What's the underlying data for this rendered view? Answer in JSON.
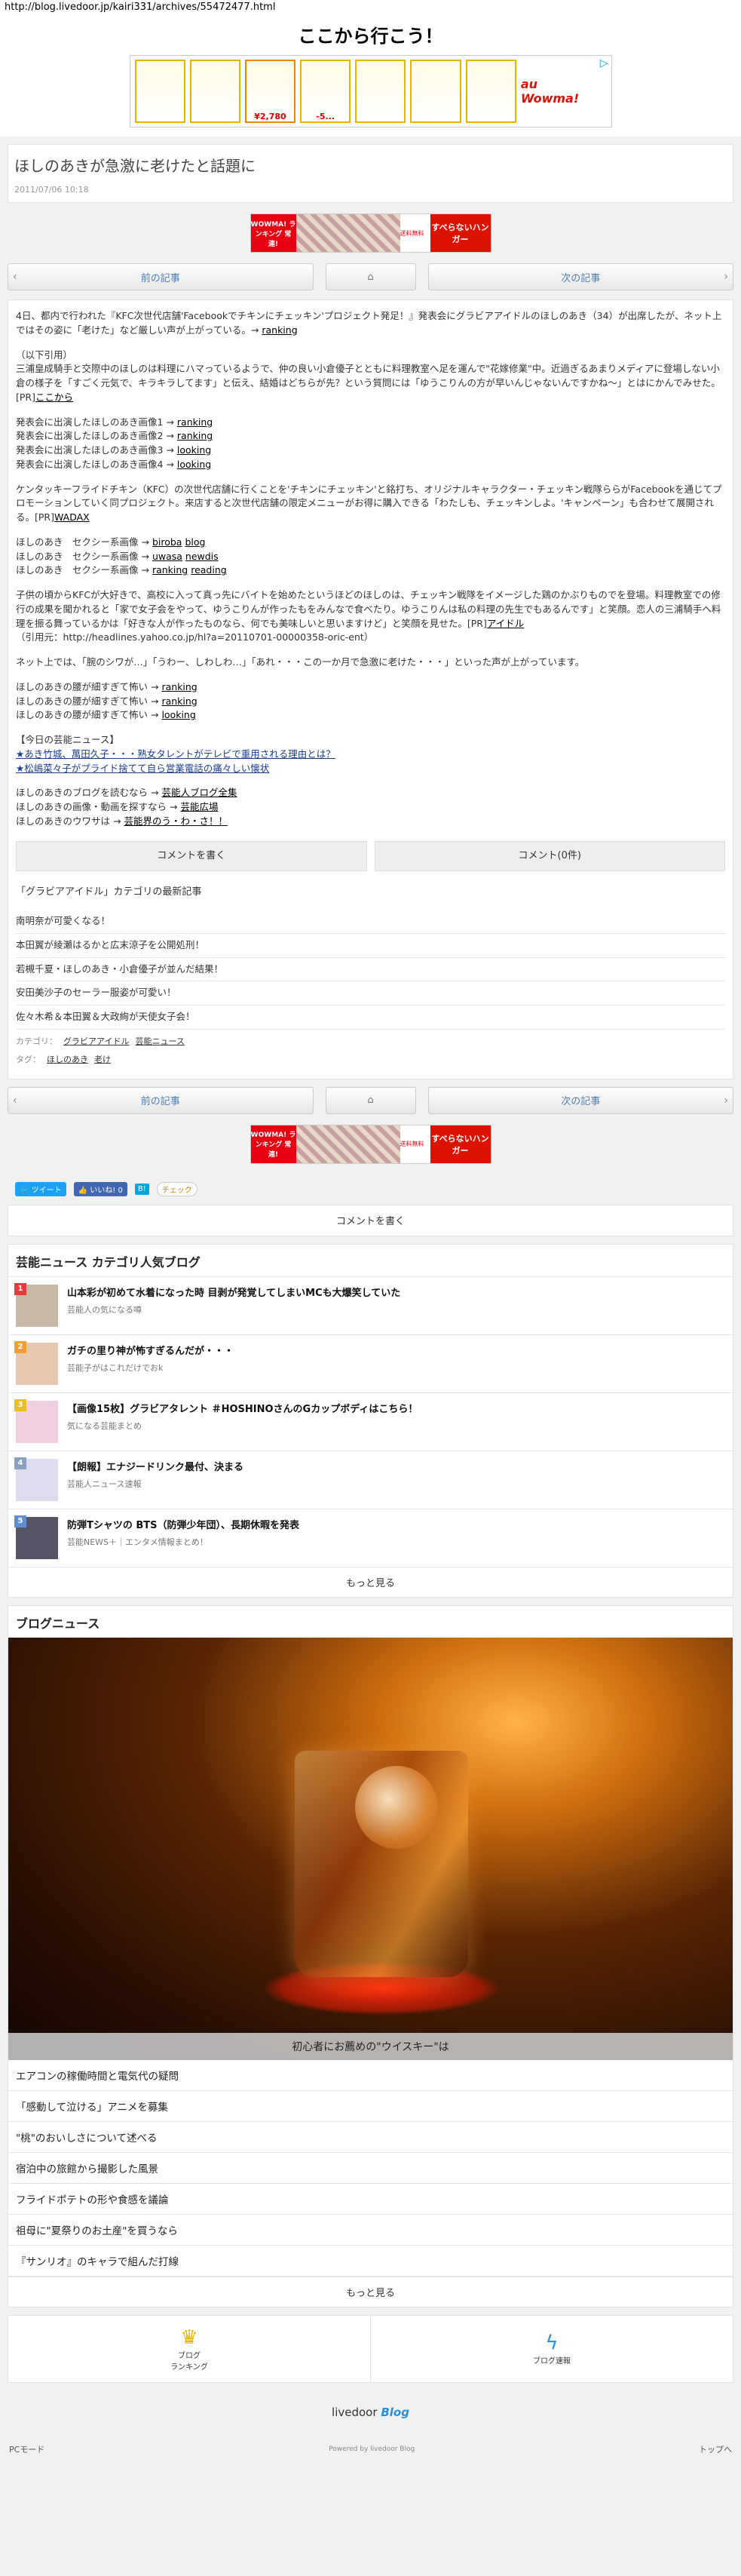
{
  "url": "http://blog.livedoor.jp/kairi331/archives/55472477.html",
  "page_heading": "ここから行こう！",
  "banner": {
    "price": "¥2,780",
    "discount": "-5...",
    "logo": "au Wowma!"
  },
  "post": {
    "title": "ほしのあきが急激に老けたと話題に",
    "date": "2011/07/06 10:18"
  },
  "wowma_ad": {
    "left": "WOWMA! ランキング 常連!",
    "badge": "送料無料",
    "right": "すべらないハンガー"
  },
  "nav": {
    "prev": "前の記事",
    "next": "次の記事"
  },
  "article": {
    "intro": "4日、都内で行われた『KFC次世代店舗'Facebookでチキンにチェッキン'プロジェクト発足！』発表会にグラビアアイドルのほしのあき（34）が出席したが、ネット上ではその姿に「老けた」など厳しい声が上がっている。→",
    "intro_link": "ranking",
    "quote_head": "（以下引用）",
    "quote_body": "三浦皇成騎手と交際中のほしのは料理にハマっているようで、仲の良い小倉優子とともに料理教室へ足を運んで\"花嫁修業\"中。近過ぎるあまりメディアに登場しない小倉の様子を「すごく元気で、キラキラしてます」と伝え、結婚はどちらが先？という質問には「ゆうこりんの方が早いんじゃないんですかね～」とはにかんでみせた。[PR]",
    "quote_link": "ここから",
    "img_lines": [
      {
        "text": "発表会に出演したほしのあき画像1 →",
        "link": "ranking"
      },
      {
        "text": "発表会に出演したほしのあき画像2 →",
        "link": "ranking"
      },
      {
        "text": "発表会に出演したほしのあき画像3 →",
        "link": "looking"
      },
      {
        "text": "発表会に出演したほしのあき画像4 →",
        "link": "looking"
      }
    ],
    "kfc_para": "ケンタッキーフライドチキン（KFC）の次世代店舗に行くことを'チキンにチェッキン'と銘打ち、オリジナルキャラクター・チェッキン戦隊ららがFacebookを通じてプロモーションしていく同プロジェクト。来店すると次世代店舗の限定メニューがお得に購入できる「わたしも、チェッキンしよ。'キャンペーン」も合わせて展開される。[PR]",
    "kfc_link": "WADAX",
    "sexy_lines": [
      {
        "text": "ほしのあき　セクシー系画像 →",
        "links": [
          "biroba",
          "blog"
        ]
      },
      {
        "text": "ほしのあき　セクシー系画像 →",
        "links": [
          "uwasa",
          "newdis"
        ]
      },
      {
        "text": "ほしのあき　セクシー系画像 →",
        "links": [
          "ranking",
          "reading"
        ]
      }
    ],
    "story_para": "子供の頃からKFCが大好きで、高校に入って真っ先にバイトを始めたというほどのほしのは、チェッキン戦隊をイメージした鶏のかぶりものでを登場。料理教室での修行の成果を聞かれると「家で女子会をやって、ゆうこりんが作ったもをみんなで食べたり。ゆうこりんは私の料理の先生でもあるんです」と笑顔。恋人の三浦騎手へ料理を振る舞っているかは「好きな人が作ったものなら、何でも美味しいと思いますけど」と笑顔を見せた。[PR]",
    "story_link": "アイドル",
    "source": "（引用元：http://headlines.yahoo.co.jp/hl?a=20110701-00000358-oric-ent）",
    "net_para": "ネット上では、「腕のシワが…」「うわー、しわしわ…」「あれ・・・この一か月で急激に老けた・・・」といった声が上がっています。",
    "waist_lines": [
      {
        "text": "ほしのあきの腰が細すぎて怖い →",
        "link": "ranking"
      },
      {
        "text": "ほしのあきの腰が細すぎて怖い →",
        "link": "ranking"
      },
      {
        "text": "ほしのあきの腰が細すぎて怖い →",
        "link": "looking"
      }
    ],
    "today_head": "【今日の芸能ニュース】",
    "today_items": [
      "★あき竹城、萬田久子・・・熟女タレントがテレビで重用される理由とは？",
      "★松嶋菜々子がプライド捨てて自ら営業電話の痛々しい懐状"
    ],
    "more_lines": [
      {
        "text": "ほしのあきのブログを読むなら →",
        "link": "芸能人ブログ全集"
      },
      {
        "text": "ほしのあきの画像・動画を探すなら →",
        "link": "芸能広場"
      },
      {
        "text": "ほしのあきのウワサは →",
        "link": "芸能界のう・わ・さ！！"
      }
    ]
  },
  "buttons": {
    "write_comment": "コメントを書く",
    "comment_count": "コメント(0件)"
  },
  "category": {
    "heading": "「グラビアアイドル」カテゴリの最新記事",
    "items": [
      "南明奈が可愛くなる！",
      "本田翼が綾瀬はるかと広末涼子を公開処刑！",
      "若槻千夏・ほしのあき・小倉優子が並んだ結果！",
      "安田美沙子のセーラー服姿が可愛い！",
      "佐々木希＆本田翼＆大政絢が天使女子会！"
    ],
    "cat_label": "カテゴリ：",
    "cat_values": [
      "グラビアアイドル",
      "芸能ニュース"
    ],
    "tag_label": "タグ：",
    "tag_values": [
      "ほしのあき",
      "老け"
    ]
  },
  "social": {
    "tweet": "ツイート",
    "like": "いいね! 0",
    "hatena": "B!",
    "mixi": "チェック"
  },
  "comment_bar": "コメントを書く",
  "ranking": {
    "title": "芸能ニュース カテゴリ人気ブログ",
    "items": [
      {
        "num": "1",
        "title": "山本彩が初めて水着になった時 目剥が発覚してしまいMCも大爆笑していた",
        "sub": "芸能人の気になる噂",
        "color": "#e43b3b"
      },
      {
        "num": "2",
        "title": "ガチの里り神が怖すぎるんだが・・・",
        "sub": "芸能子がはこれだけでおk",
        "color": "#f0a030"
      },
      {
        "num": "3",
        "title": "【画像15枚】グラビアタレント ＃HOSHINOさんのGカップボディはこちら！",
        "sub": "気になる芸能まとめ",
        "color": "#e8c020"
      },
      {
        "num": "4",
        "title": "【朗報】エナジードリンク最付、決まる",
        "sub": "芸能人ニュース速報",
        "color": "#8aa0c0"
      },
      {
        "num": "5",
        "title": "防弾Tシャツの BTS（防弾少年団）、長期休暇を発表",
        "sub": "芸能NEWS＋｜エンタメ情報まとめ！",
        "color": "#5f8fd0"
      }
    ],
    "more": "もっと見る"
  },
  "blog_news": {
    "title": "ブログニュース",
    "caption": "初心者にお薦めの\"ウイスキー\"は",
    "items": [
      "エアコンの稼働時間と電気代の疑問",
      "「感動して泣ける」アニメを募集",
      "\"桃\"のおいしさについて述べる",
      "宿泊中の旅館から撮影した風景",
      "フライドポテトの形や食感を議論",
      "祖母に\"夏祭りのお土産\"を買うなら",
      "『サンリオ』のキャラで組んだ打線"
    ],
    "more": "もっと見る"
  },
  "footer": {
    "ranking_label": "ブログ\nランキング",
    "news_label": "ブログ速報",
    "logo_main": "livedoor",
    "logo_blog": "Blog",
    "pc_mode": "PCモード",
    "powered": "Powered by livedoor Blog",
    "top": "トップへ"
  }
}
